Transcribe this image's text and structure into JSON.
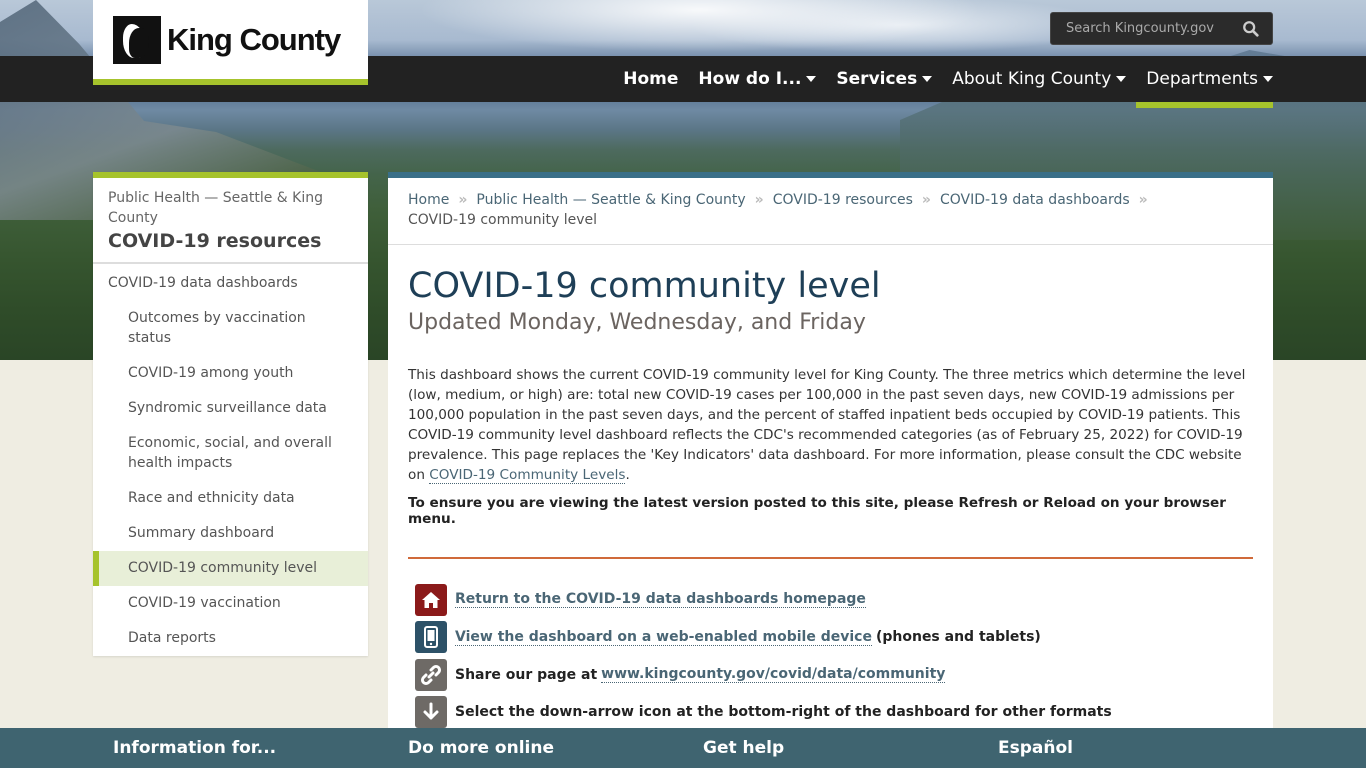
{
  "header": {
    "logo_text": "King County",
    "search": {
      "placeholder": "Search Kingcounty.gov"
    },
    "nav": [
      {
        "label": "Home",
        "has_caret": false,
        "bold": true
      },
      {
        "label": "How do I...",
        "has_caret": true,
        "bold": true
      },
      {
        "label": "Services",
        "has_caret": true,
        "bold": true
      },
      {
        "label": "About King County",
        "has_caret": true,
        "bold": false
      },
      {
        "label": "Departments",
        "has_caret": true,
        "bold": false,
        "active": true
      }
    ]
  },
  "sidebar": {
    "parent_link": "Public Health — Seattle & King County",
    "section_title": "COVID-19 resources",
    "items": [
      {
        "label": "COVID-19 data dashboards",
        "level": 1
      },
      {
        "label": "Outcomes by vaccination status",
        "level": 2
      },
      {
        "label": "COVID-19 among youth",
        "level": 2
      },
      {
        "label": "Syndromic surveillance data",
        "level": 2
      },
      {
        "label": "Economic, social, and overall health impacts",
        "level": 2
      },
      {
        "label": "Race and ethnicity data",
        "level": 2
      },
      {
        "label": "Summary dashboard",
        "level": 2
      },
      {
        "label": "COVID-19 community level",
        "level": 2,
        "active": true
      },
      {
        "label": "COVID-19 vaccination",
        "level": 2
      },
      {
        "label": "Data reports",
        "level": 2
      }
    ]
  },
  "breadcrumb": {
    "items": [
      "Home",
      "Public Health — Seattle & King County",
      "COVID-19 resources",
      "COVID-19 data dashboards"
    ],
    "separator": "»",
    "current": "COVID-19 community level"
  },
  "main": {
    "title": "COVID-19 community level",
    "subtitle": "Updated Monday, Wednesday, and Friday",
    "intro_text": "This dashboard shows the current COVID-19 community level for King County. The three metrics which determine the level (low, medium, or high) are: total new COVID-19 cases per 100,000 in the past seven days, new COVID-19 admissions per 100,000 population in the past seven days, and the percent of staffed inpatient beds occupied by COVID-19 patients. This COVID-19 community level dashboard reflects the CDC's recommended categories (as of February 25, 2022) for COVID-19 prevalence. This page replaces the 'Key Indicators' data dashboard. For more information, please consult the CDC website on ",
    "intro_link": "COVID-19 Community Levels",
    "intro_end": ".",
    "notice": "To ensure you are viewing the latest version posted to this site, please Refresh or Reload on your browser menu.",
    "links": [
      {
        "icon": "home-icon",
        "color": "#8b1a1a",
        "link": "Return to the COVID-19 data dashboards homepage",
        "prefix": "",
        "suffix": ""
      },
      {
        "icon": "mobile-icon",
        "color": "#2d5268",
        "link": "View the dashboard on a web-enabled mobile device",
        "prefix": "",
        "suffix": "(phones and tablets)"
      },
      {
        "icon": "link-icon",
        "color": "#6e6a66",
        "link": "www.kingcounty.gov/covid/data/community",
        "prefix": "Share our page at",
        "suffix": ""
      },
      {
        "icon": "down-arrow-icon",
        "color": "#6e6a66",
        "link": "",
        "prefix": "Select the down-arrow icon at the bottom-right of the dashboard for other formats",
        "suffix": ""
      }
    ]
  },
  "footer": {
    "items": [
      "Information for...",
      "Do more online",
      "Get help",
      "Español"
    ]
  },
  "colors": {
    "accent_green": "#a6c32c",
    "nav_dark": "#222222",
    "content_top_border": "#3a6f88",
    "divider_orange": "#d06a3a",
    "footer_bg": "#3f6470",
    "title_blue": "#1e3f57"
  }
}
